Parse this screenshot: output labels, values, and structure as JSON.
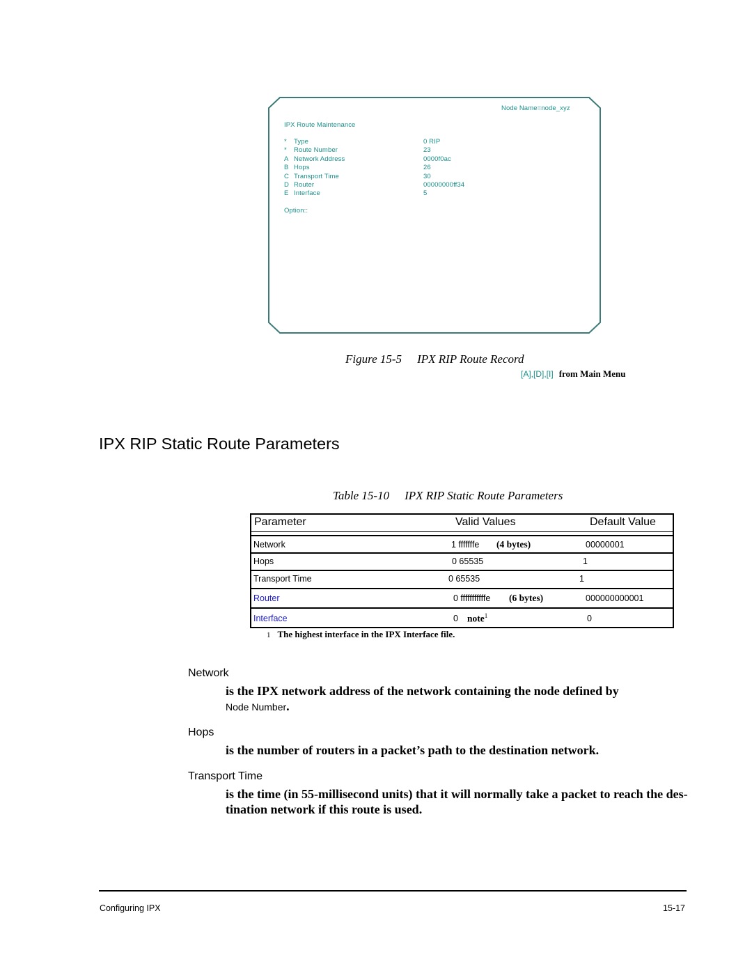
{
  "figure": {
    "screen": {
      "node_name": "Node Name=node_xyz",
      "title": "IPX Route Maintenance",
      "fields": [
        {
          "key": "*",
          "label": "Type",
          "value": "0 RIP"
        },
        {
          "key": "*",
          "label": "Route Number",
          "value": "23"
        },
        {
          "key": "A",
          "label": "Network Address",
          "value": "0000f0ac"
        },
        {
          "key": "B",
          "label": "Hops",
          "value": "26"
        },
        {
          "key": "C",
          "label": "Transport Time",
          "value": "30"
        },
        {
          "key": "D",
          "label": "Router",
          "value": "00000000ff34"
        },
        {
          "key": "E",
          "label": "Interface",
          "value": "5"
        }
      ],
      "option_prompt": "Option::"
    },
    "caption_number": "Figure 15-5",
    "caption_title": "IPX RIP Route Record",
    "menu_keys": "[A],[D],[I]",
    "menu_from": "from Main Menu"
  },
  "section_title": "IPX RIP Static Route Parameters",
  "table": {
    "caption_number": "Table 15-10",
    "caption_title": "IPX RIP Static Route Parameters",
    "headers": [
      "Parameter",
      "Valid Values",
      "Default Value"
    ],
    "rows": [
      {
        "parameter": "Network",
        "valid": "1 fffffffe",
        "valid_note": "(4 bytes)",
        "default": "00000001",
        "link": false
      },
      {
        "parameter": "Hops",
        "valid": "0 65535",
        "valid_note": "",
        "default": "1",
        "link": false
      },
      {
        "parameter": "Transport Time",
        "valid": "0 65535",
        "valid_note": "",
        "default": "1",
        "link": false
      },
      {
        "parameter": "Router",
        "valid": "0 fffffffffffe",
        "valid_note": "(6 bytes)",
        "default": "000000000001",
        "link": true
      },
      {
        "parameter": "Interface",
        "valid": "0",
        "valid_note": "note",
        "valid_sup": "1",
        "default": "0",
        "link": true
      }
    ],
    "footnote_number": "1",
    "footnote_text": "The highest interface in the IPX Interface file."
  },
  "definitions": [
    {
      "term": "Network",
      "text": "is the IPX network address of the network containing the node defined by",
      "ref": "Node Number",
      "tail": "."
    },
    {
      "term": "Hops",
      "text": "is the number of routers in a packet’s path to the destination network."
    },
    {
      "term": "Transport Time",
      "line1": "is the time (in 55-millisecond units) that it will normally take a packet to reach the des-",
      "line2": "tination network if this route is used."
    }
  ],
  "footer": {
    "left": "Configuring IPX",
    "right": "15-17"
  },
  "colors": {
    "terminal_text": "#1b8f8a",
    "terminal_border": "#3b7a78",
    "link": "#1a1acc"
  }
}
